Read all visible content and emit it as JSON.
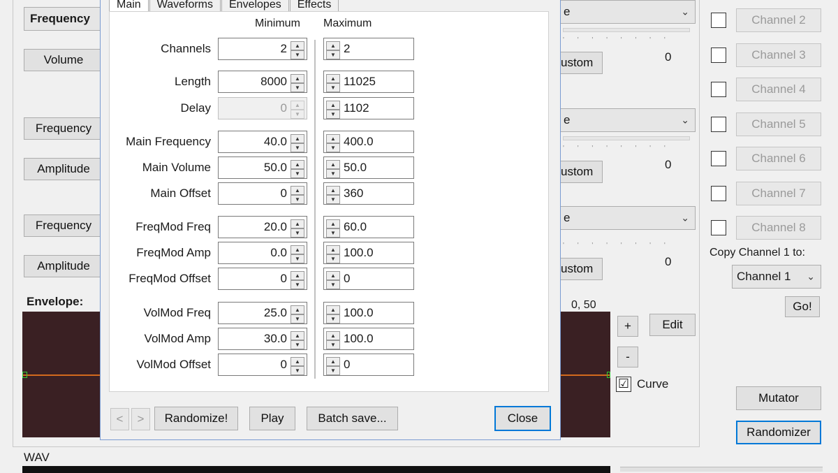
{
  "left": {
    "frequency_label": "Frequency",
    "volume_btn": "Volume",
    "frequency_btn_1": "Frequency",
    "amplitude_btn_1": "Amplitude",
    "frequency_btn_2": "Frequency",
    "amplitude_btn_2": "Amplitude",
    "envelope_label": "Envelope:",
    "wav_label": "WAV"
  },
  "middle": {
    "combo_1": "e",
    "combo_2": "e",
    "combo_3": "e",
    "custom_1": "ustom",
    "custom_2": "ustom",
    "custom_3": "ustom",
    "slider_val_1": "0",
    "slider_val_2": "0",
    "slider_val_3": "0",
    "env_coord": "0, 50",
    "plus_btn": "+",
    "minus_btn": "-",
    "edit_btn": "Edit",
    "curve_label": "Curve",
    "curve_check": "☑"
  },
  "right": {
    "channels": [
      "Channel 2",
      "Channel 3",
      "Channel 4",
      "Channel 5",
      "Channel 6",
      "Channel 7",
      "Channel 8"
    ],
    "copy_label": "Copy Channel 1 to:",
    "copy_select": "Channel 1",
    "go_btn": "Go!",
    "mutator_btn": "Mutator",
    "randomizer_btn": "Randomizer"
  },
  "dialog": {
    "tabs": [
      "Main",
      "Waveforms",
      "Envelopes",
      "Effects"
    ],
    "col_min": "Minimum",
    "col_max": "Maximum",
    "rows": [
      {
        "label": "Channels",
        "min": "2",
        "max": "2"
      },
      {
        "label": "Length",
        "min": "8000",
        "max": "11025"
      },
      {
        "label": "Delay",
        "min": "0",
        "max": "1102"
      },
      {
        "label": "Main Frequency",
        "min": "40.0",
        "max": "400.0"
      },
      {
        "label": "Main Volume",
        "min": "50.0",
        "max": "50.0"
      },
      {
        "label": "Main Offset",
        "min": "0",
        "max": "360"
      },
      {
        "label": "FreqMod Freq",
        "min": "20.0",
        "max": "60.0"
      },
      {
        "label": "FreqMod Amp",
        "min": "0.0",
        "max": "100.0"
      },
      {
        "label": "FreqMod Offset",
        "min": "0",
        "max": "0"
      },
      {
        "label": "VolMod Freq",
        "min": "25.0",
        "max": "100.0"
      },
      {
        "label": "VolMod Amp",
        "min": "30.0",
        "max": "100.0"
      },
      {
        "label": "VolMod Offset",
        "min": "0",
        "max": "0"
      }
    ],
    "prev_btn": "<",
    "next_btn": ">",
    "randomize_btn": "Randomize!",
    "play_btn": "Play",
    "batch_btn": "Batch save...",
    "close_btn": "Close"
  },
  "colors": {
    "envelope_bg": "#3a2023",
    "envelope_line": "#d2691e",
    "dialog_border": "#7a9bd1",
    "focus_border": "#0078d7"
  }
}
